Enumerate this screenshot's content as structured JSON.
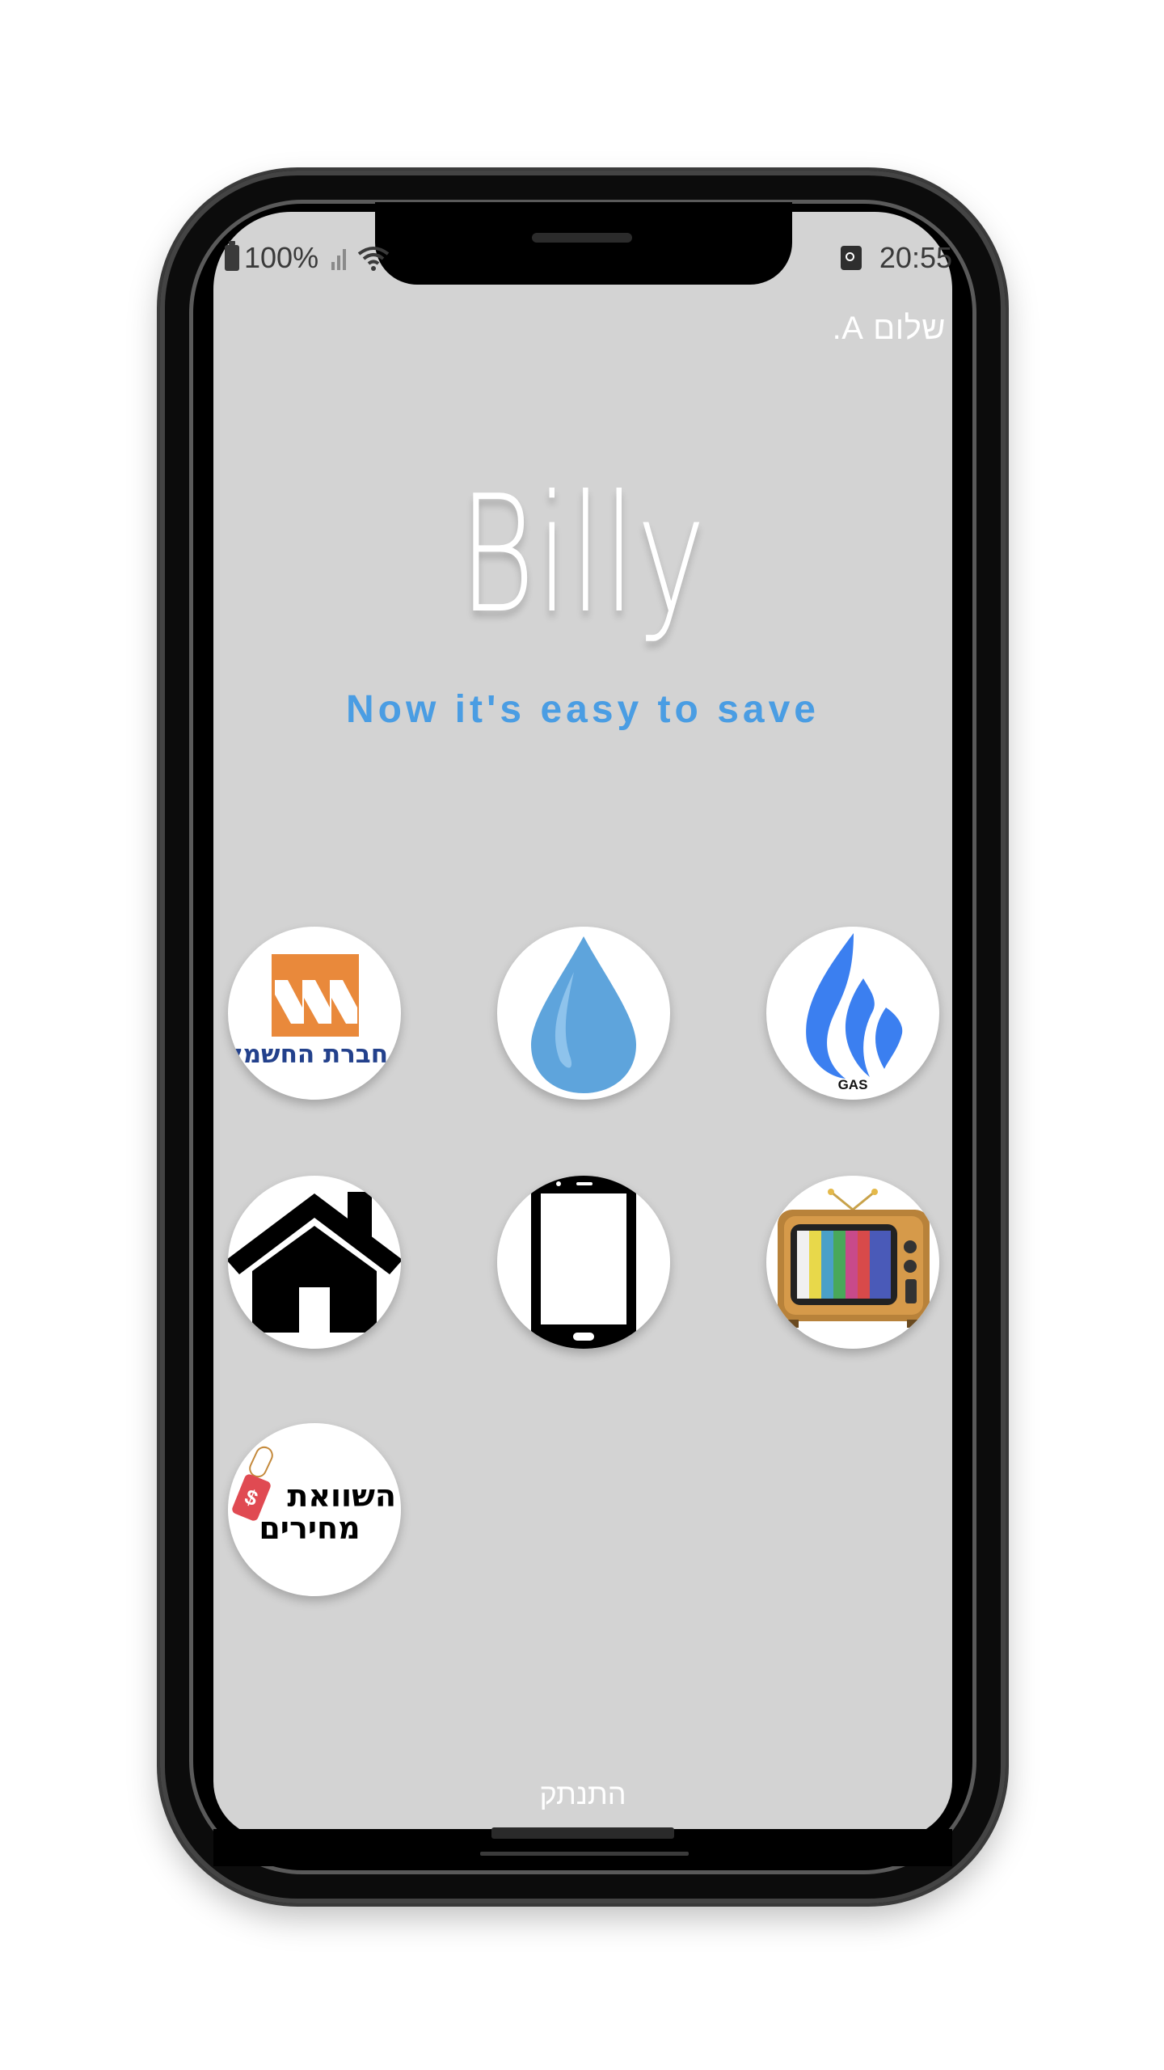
{
  "status_bar": {
    "battery_text": "100%",
    "time": "20:55",
    "icons": [
      "battery-icon",
      "signal-icon",
      "wifi-icon",
      "alarm-icon"
    ]
  },
  "header": {
    "greeting": "שלום A."
  },
  "hero": {
    "title": "Billy",
    "tagline": "Now it's easy to save"
  },
  "providers": [
    {
      "id": "electricity",
      "icon": "electric-company-icon",
      "label": "חברת החשמל"
    },
    {
      "id": "water",
      "icon": "water-drop-icon"
    },
    {
      "id": "gas",
      "icon": "gas-flame-icon",
      "label": "GAS"
    },
    {
      "id": "home",
      "icon": "house-icon"
    },
    {
      "id": "phone",
      "icon": "smartphone-icon"
    },
    {
      "id": "tv",
      "icon": "tv-icon"
    },
    {
      "id": "compare",
      "icon": "price-compare-icon",
      "label_line1": "השוואת",
      "label_line2": "מחירים",
      "tag_symbol": "$"
    }
  ],
  "footer": {
    "logout_label": "התנתק"
  },
  "colors": {
    "screen_bg": "#d3d3d3",
    "tagline": "#4a9de3",
    "electric_orange": "#e9893b",
    "electric_blue": "#23418c",
    "water_blue": "#5ea4dc",
    "gas_blue": "#3b7ff0"
  }
}
